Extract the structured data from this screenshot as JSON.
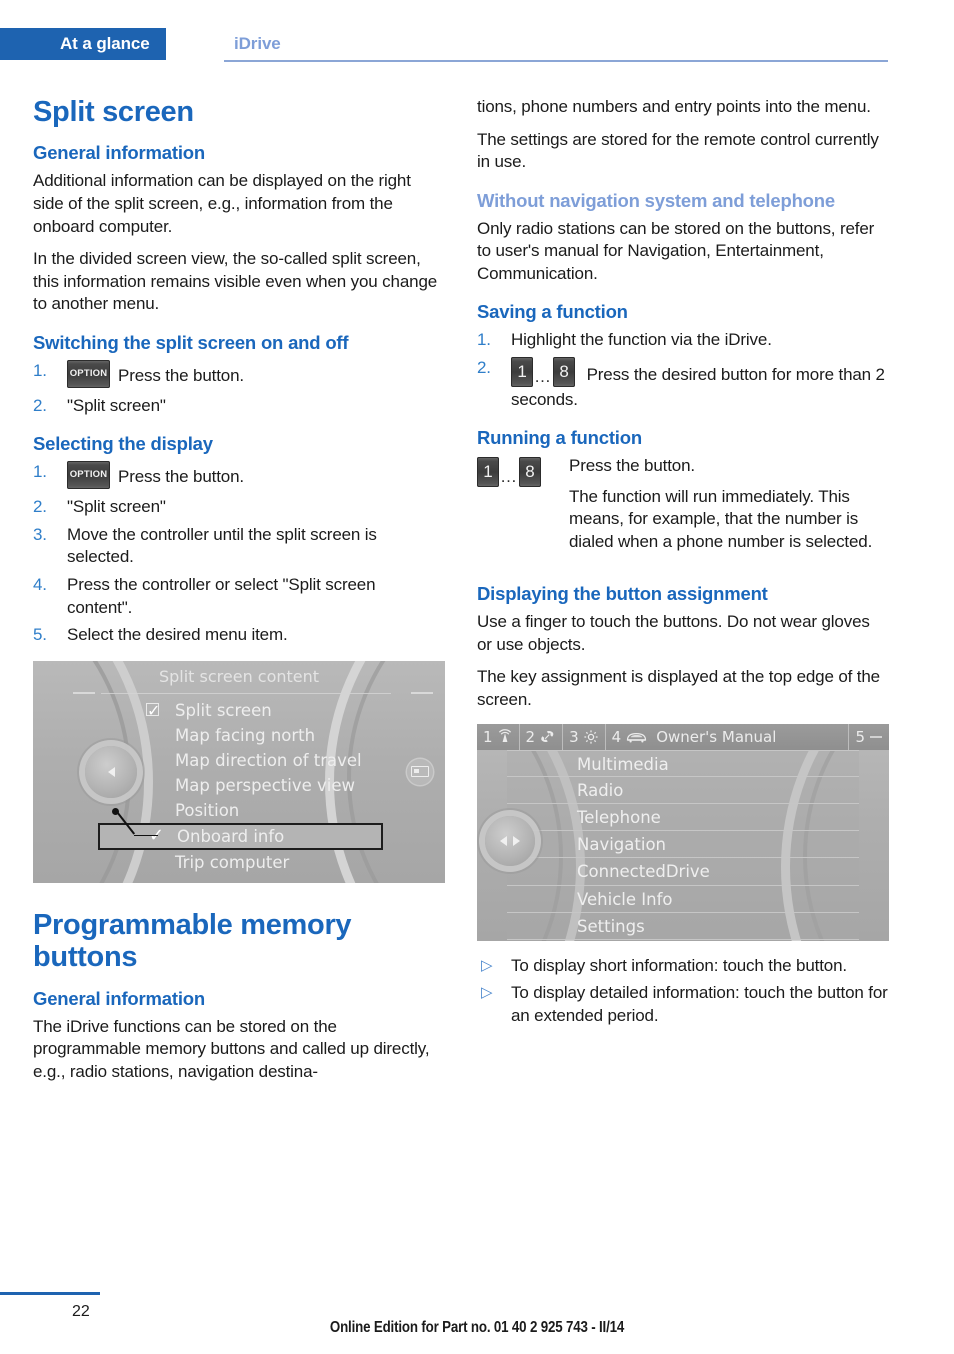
{
  "header": {
    "chapter": "At a glance",
    "section": "iDrive"
  },
  "left_column": {
    "title": "Split screen",
    "general_information_heading": "General information",
    "general_p1": "Additional information can be displayed on the right side of the split screen, e.g., information from the onboard computer.",
    "general_p2": "In the divided screen view, the so-called split screen, this information remains visible even when you change to another menu.",
    "switching_heading": "Switching the split screen on and off",
    "switching_steps": [
      {
        "num": "1.",
        "icon": "OPTION",
        "text": "Press the button."
      },
      {
        "num": "2.",
        "text": "\"Split screen\""
      }
    ],
    "selecting_heading": "Selecting the display",
    "selecting_steps": [
      {
        "num": "1.",
        "icon": "OPTION",
        "text": "Press the button."
      },
      {
        "num": "2.",
        "text": "\"Split screen\""
      },
      {
        "num": "3.",
        "text": "Move the controller until the split screen is selected."
      },
      {
        "num": "4.",
        "text": "Press the controller or select \"Split screen content\"."
      },
      {
        "num": "5.",
        "text": "Select the desired menu item."
      }
    ],
    "title2": "Programmable memory buttons",
    "general_information_heading2": "General information",
    "general2_p1": "The iDrive functions can be stored on the programmable memory buttons and called up directly, e.g., radio stations, navigation destina-"
  },
  "right_column": {
    "continued_p1": "tions, phone numbers and entry points into the menu.",
    "continued_p2": "The settings are stored for the remote control currently in use.",
    "without_nav_heading": "Without navigation system and telephone",
    "without_nav_p1": "Only radio stations can be stored on the buttons, refer to user's manual for Navigation, Entertainment, Communication.",
    "saving_heading": "Saving a function",
    "saving_steps": [
      {
        "num": "1.",
        "text": "Highlight the function via the iDrive."
      },
      {
        "num": "2.",
        "icon": "1...8",
        "text": "Press the desired button for more than 2 seconds."
      }
    ],
    "running_heading": "Running a function",
    "running_icon": "1...8",
    "running_p1": "Press the button.",
    "running_p2": "The function will run immediately. This means, for example, that the number is dialed when a phone number is selected.",
    "displaying_heading": "Displaying the button assignment",
    "displaying_p1": "Use a finger to touch the buttons. Do not wear gloves or use objects.",
    "displaying_p2": "The key assignment is displayed at the top edge of the screen.",
    "bullets": [
      {
        "marker": "▷",
        "text": "To display short information: touch the button."
      },
      {
        "marker": "▷",
        "text": "To display detailed information: touch the button for an extended period."
      }
    ]
  },
  "figure_split_screen": {
    "screen_title": "Split screen content",
    "menu_items": [
      {
        "label": "Split screen",
        "marker": "checkbox-checked",
        "selected": false
      },
      {
        "label": "Map facing north",
        "marker": "none",
        "selected": false
      },
      {
        "label": "Map direction of travel",
        "marker": "none",
        "selected": false
      },
      {
        "label": "Map perspective view",
        "marker": "none",
        "selected": false
      },
      {
        "label": "Position",
        "marker": "none",
        "selected": false
      },
      {
        "label": "Onboard info",
        "marker": "check",
        "selected": true
      },
      {
        "label": "Trip computer",
        "marker": "none",
        "selected": false
      }
    ]
  },
  "figure_main_menu": {
    "key_bar": [
      {
        "num": "1",
        "icon": "radio-waves-icon",
        "label": ""
      },
      {
        "num": "2",
        "icon": "phone-handset-icon",
        "label": ""
      },
      {
        "num": "3",
        "icon": "gear-icon",
        "label": ""
      },
      {
        "num": "4",
        "icon": "car-icon",
        "label": "Owner's Manual"
      },
      {
        "num": "5",
        "icon": "dash-icon",
        "label": ""
      }
    ],
    "menu_items": [
      "Multimedia",
      "Radio",
      "Telephone",
      "Navigation",
      "ConnectedDrive",
      "Vehicle Info",
      "Settings"
    ]
  },
  "footer": {
    "page_number": "22",
    "edition": "Online Edition for Part no. 01 40 2 925 743 - II/14"
  },
  "colors": {
    "brand_blue": "#1e63b0",
    "heading_blue": "#1a67bc",
    "light_blue": "#7e9ed8",
    "step_number_blue": "#2f7ec9"
  }
}
